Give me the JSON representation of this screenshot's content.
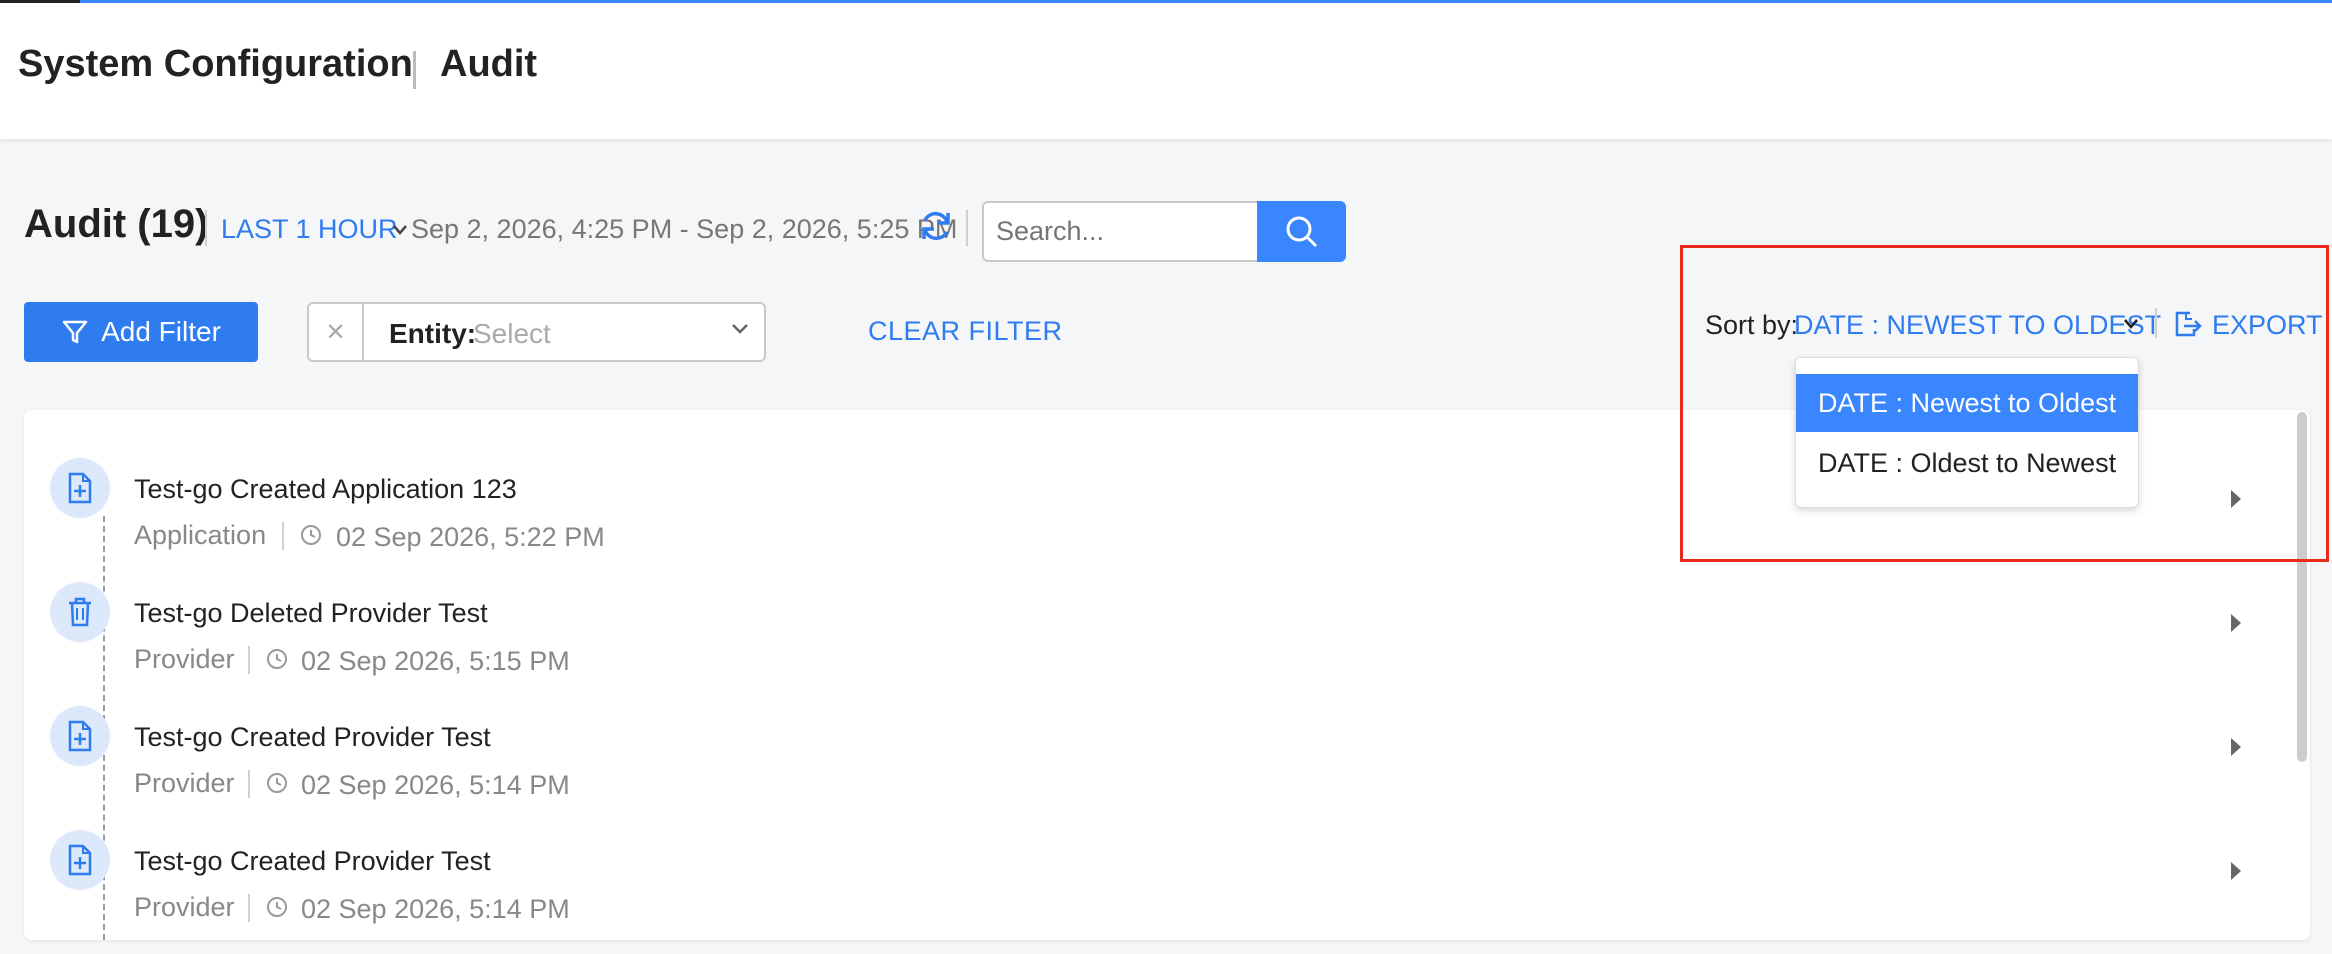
{
  "header": {
    "crumb_parent": "System Configuration",
    "crumb_current": "Audit"
  },
  "toolbar": {
    "title": "Audit (19)",
    "range_label": "LAST 1 HOUR",
    "date_range": "Sep 2, 2026, 4:25 PM - Sep 2, 2026, 5:25 PM",
    "search_placeholder": "Search...",
    "add_filter_label": "Add Filter",
    "entity_label": "Entity:",
    "entity_placeholder": "Select",
    "clear_filter_label": "CLEAR FILTER",
    "sort_label": "Sort by:",
    "sort_value": "DATE : NEWEST TO OLDEST",
    "export_label": "EXPORT"
  },
  "sort_options": [
    "DATE : Newest to Oldest",
    "DATE : Oldest to Newest"
  ],
  "rows": [
    {
      "title": "Test-go Created Application 123",
      "entity": "Application",
      "time": "02 Sep 2026, 5:22 PM",
      "icon": "file-plus-icon"
    },
    {
      "title": "Test-go Deleted Provider Test",
      "entity": "Provider",
      "time": "02 Sep 2026, 5:15 PM",
      "icon": "trash-icon"
    },
    {
      "title": "Test-go Created Provider Test",
      "entity": "Provider",
      "time": "02 Sep 2026, 5:14 PM",
      "icon": "file-plus-icon"
    },
    {
      "title": "Test-go Created Provider Test",
      "entity": "Provider",
      "time": "02 Sep 2026, 5:14 PM",
      "icon": "file-plus-icon"
    }
  ],
  "colors": {
    "accent": "#3a86ff",
    "link": "#2f7bf0",
    "highlight": "#e8291c"
  }
}
